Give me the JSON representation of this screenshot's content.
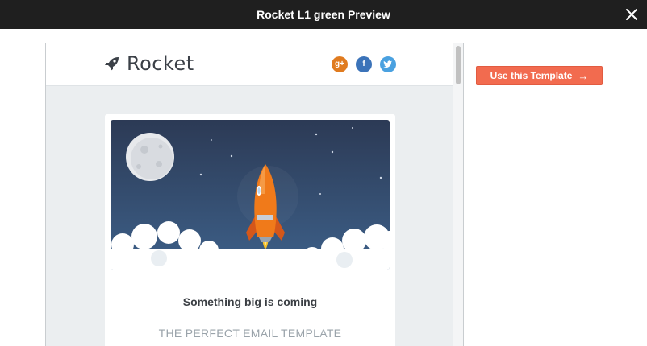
{
  "window": {
    "title": "Rocket L1 green Preview"
  },
  "email": {
    "brand_name": "Rocket",
    "social": [
      "g+",
      "f",
      "twitter-bird"
    ],
    "heading": "Something big is coming",
    "subheading": "THE PERFECT EMAIL TEMPLATE"
  },
  "actions": {
    "use_template_label": "Use this Template",
    "use_template_icon": "→"
  },
  "colors": {
    "topbar": "#1f1f1f",
    "accent": "#f26b4f",
    "hero_sky": "#3a5578",
    "rocket": "#f07a1a"
  },
  "icons": {
    "close": "close-icon",
    "brand": "rocket-icon",
    "arrow": "arrow-right-icon"
  }
}
